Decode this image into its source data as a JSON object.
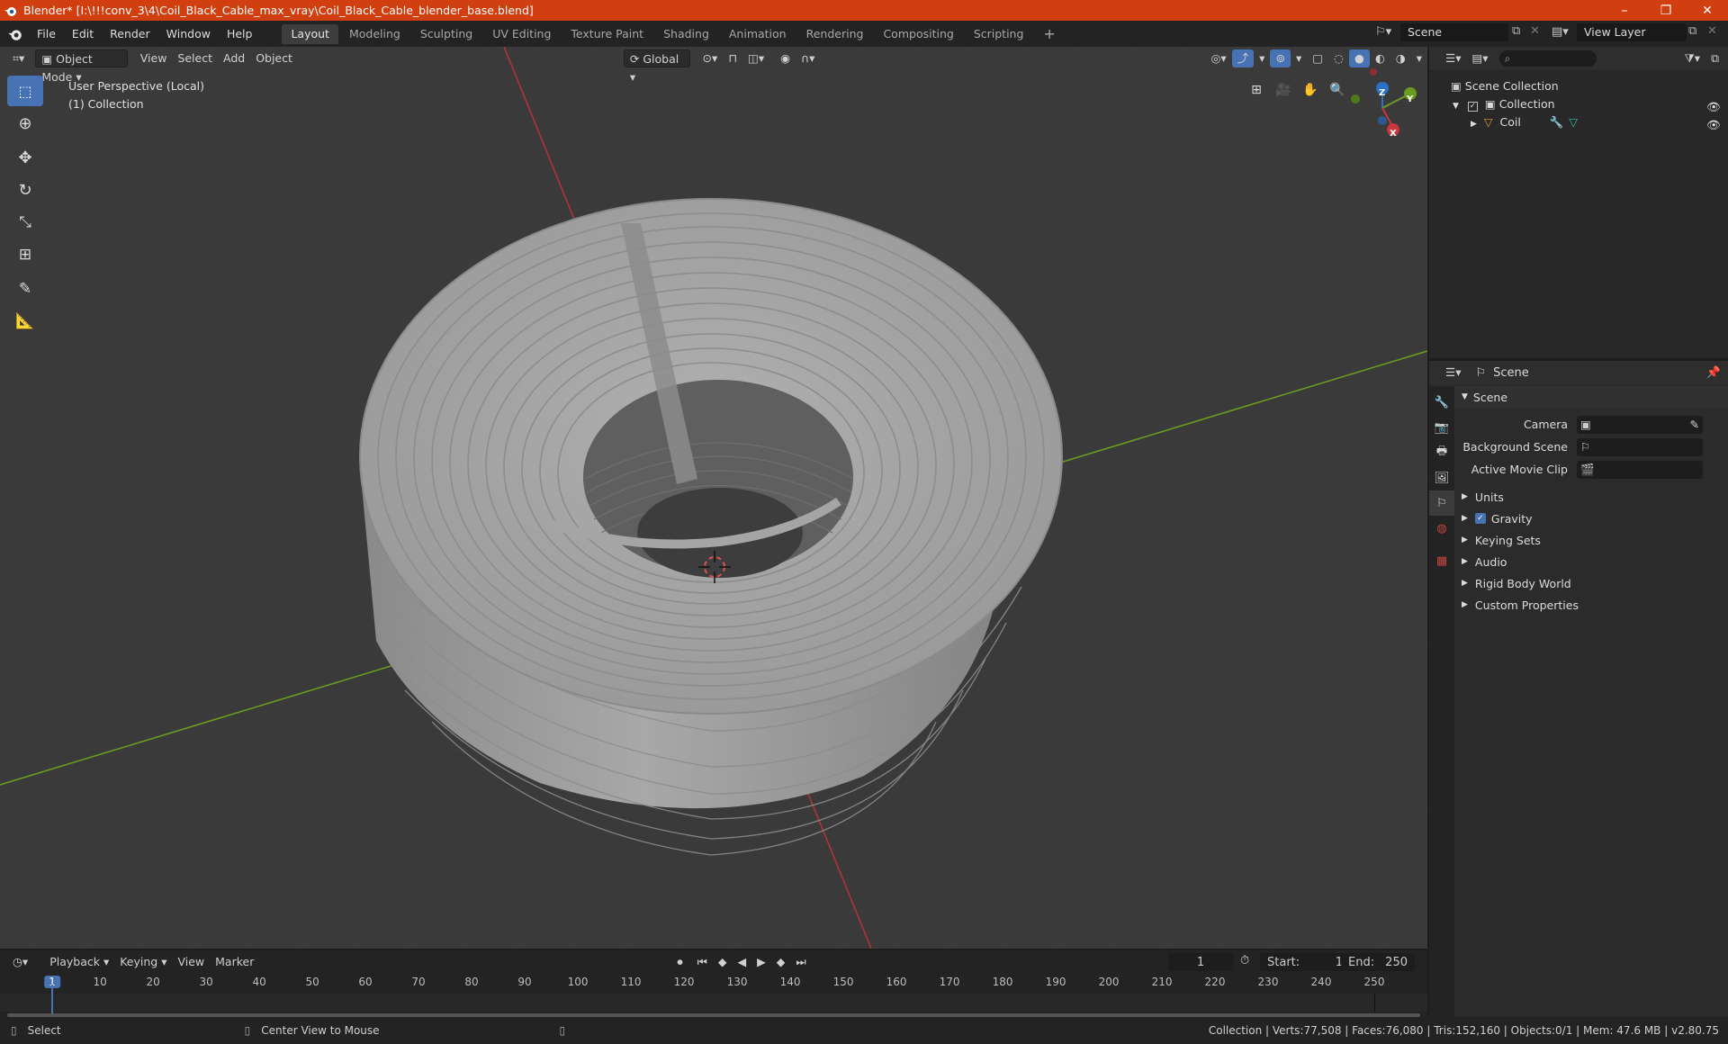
{
  "window": {
    "title": "Blender* [I:\\!!!conv_3\\4\\Coil_Black_Cable_max_vray\\Coil_Black_Cable_blender_base.blend]",
    "minimize": "–",
    "restore": "❐",
    "close": "✕"
  },
  "menu": [
    "File",
    "Edit",
    "Render",
    "Window",
    "Help"
  ],
  "workspaces": [
    "Layout",
    "Modeling",
    "Sculpting",
    "UV Editing",
    "Texture Paint",
    "Shading",
    "Animation",
    "Rendering",
    "Compositing",
    "Scripting"
  ],
  "active_workspace": "Layout",
  "scene_name": "Scene",
  "view_layer": "View Layer",
  "viewport": {
    "mode": "Object Mode",
    "menus": [
      "View",
      "Select",
      "Add",
      "Object"
    ],
    "orientation": "Global",
    "info_line1": "User Perspective (Local)",
    "info_line2": "(1) Collection",
    "gizmo": {
      "x": "X",
      "y": "Y",
      "z": "Z"
    }
  },
  "outliner": {
    "root": "Scene Collection",
    "collection": "Collection",
    "object": "Coil"
  },
  "properties": {
    "context": "Scene",
    "panel_title": "Scene",
    "fields": [
      {
        "label": "Camera",
        "value": ""
      },
      {
        "label": "Background Scene",
        "value": ""
      },
      {
        "label": "Active Movie Clip",
        "value": ""
      }
    ],
    "panels": [
      "Units",
      "Gravity",
      "Keying Sets",
      "Audio",
      "Rigid Body World",
      "Custom Properties"
    ]
  },
  "timeline": {
    "menus": [
      "Playback",
      "Keying",
      "View",
      "Marker"
    ],
    "current_frame": "1",
    "start_label": "Start:",
    "start": "1",
    "end_label": "End:",
    "end": "250",
    "ticks": [
      "1",
      "10",
      "20",
      "30",
      "40",
      "50",
      "60",
      "70",
      "80",
      "90",
      "100",
      "110",
      "120",
      "130",
      "140",
      "150",
      "160",
      "170",
      "180",
      "190",
      "200",
      "210",
      "220",
      "230",
      "240",
      "250"
    ]
  },
  "status": {
    "left": "Select",
    "middle": "Center View to Mouse",
    "right": "Collection | Verts:77,508 | Faces:76,080 | Tris:152,160 | Objects:0/1 | Mem: 47.6 MB | v2.80.75"
  },
  "colors": {
    "titlebar": "#d13e10",
    "accent": "#4772b3",
    "x_axis": "#c8363f",
    "y_axis": "#6a9b20",
    "z_axis": "#2b71c7"
  }
}
